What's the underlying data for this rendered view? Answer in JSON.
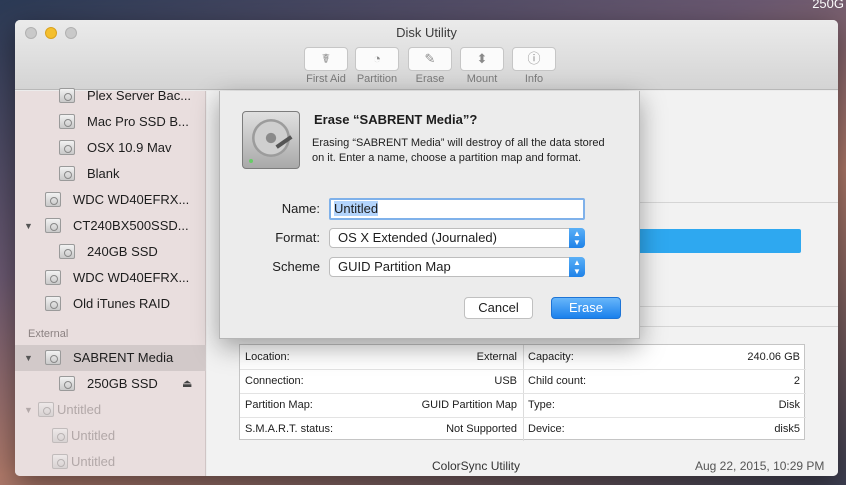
{
  "desktop": {
    "corner_label": "250G"
  },
  "window": {
    "title": "Disk Utility",
    "toolbar": [
      {
        "label": "First Aid",
        "icon": "first-aid-icon",
        "glyph": "☤"
      },
      {
        "label": "Partition",
        "icon": "partition-icon",
        "glyph": "◔"
      },
      {
        "label": "Erase",
        "icon": "erase-icon",
        "glyph": "✎"
      },
      {
        "label": "Mount",
        "icon": "mount-icon",
        "glyph": "⬍"
      },
      {
        "label": "Info",
        "icon": "info-icon",
        "glyph": "ⓘ"
      }
    ]
  },
  "sidebar": {
    "section_external": "External",
    "items": [
      {
        "label": "Plex Server Bac..."
      },
      {
        "label": "Mac Pro SSD B..."
      },
      {
        "label": "OSX 10.9 Mav"
      },
      {
        "label": "Blank"
      },
      {
        "label": "WDC WD40EFRX..."
      },
      {
        "label": "CT240BX500SSD..."
      },
      {
        "label": "240GB SSD"
      },
      {
        "label": "WDC WD40EFRX..."
      },
      {
        "label": "Old iTunes RAID"
      },
      {
        "label": "SABRENT Media",
        "selected": true
      },
      {
        "label": "250GB SSD",
        "eject": "⏏"
      },
      {
        "label": "Untitled"
      },
      {
        "label": "Untitled"
      },
      {
        "label": "Untitled"
      }
    ]
  },
  "dialog": {
    "title": "Erase “SABRENT Media”?",
    "description": "Erasing “SABRENT Media” will destroy of all the data stored on it. Enter a name, choose a partition map and format.",
    "name_label": "Name:",
    "name_value": "Untitled",
    "format_label": "Format:",
    "format_value": "OS X Extended (Journaled)",
    "scheme_label": "Scheme",
    "scheme_value": "GUID Partition Map",
    "cancel_label": "Cancel",
    "erase_label": "Erase"
  },
  "info": {
    "rows": [
      {
        "k1": "Location:",
        "v1": "External",
        "k2": "Capacity:",
        "v2": "240.06 GB"
      },
      {
        "k1": "Connection:",
        "v1": "USB",
        "k2": "Child count:",
        "v2": "2"
      },
      {
        "k1": "Partition Map:",
        "v1": "GUID Partition Map",
        "k2": "Type:",
        "v2": "Disk"
      },
      {
        "k1": "S.M.A.R.T. status:",
        "v1": "Not Supported",
        "k2": "Device:",
        "v2": "disk5"
      }
    ]
  },
  "background_list": {
    "item": "ColorSync Utility",
    "date": "Aug 22, 2015, 10:29 PM"
  },
  "colors": {
    "accent": "#1a80ec",
    "selection": "#b3d4fc",
    "capacity_bar": "#2ea8f0"
  }
}
